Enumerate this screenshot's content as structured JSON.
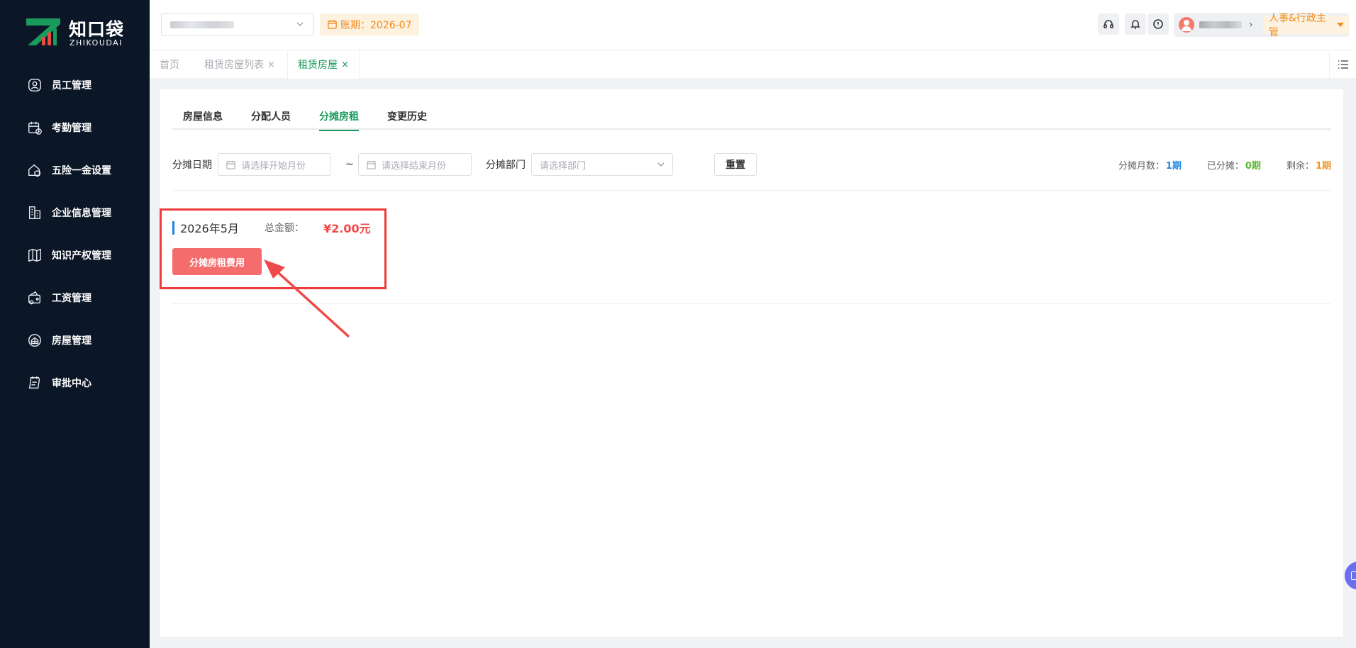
{
  "brand": {
    "name": "知口袋",
    "sub": "ZHIKOUDAI",
    "accent": "#1a9a5b",
    "sidebar_bg": "#0b1627"
  },
  "sidebar": {
    "items": [
      {
        "label": "员工管理",
        "icon": "user-circle-icon"
      },
      {
        "label": "考勤管理",
        "icon": "calendar-clock-icon"
      },
      {
        "label": "五险一金设置",
        "icon": "house-shield-icon"
      },
      {
        "label": "企业信息管理",
        "icon": "building-icon"
      },
      {
        "label": "知识产权管理",
        "icon": "book-icon"
      },
      {
        "label": "工资管理",
        "icon": "wallet-icon"
      },
      {
        "label": "房屋管理",
        "icon": "house-grid-icon"
      },
      {
        "label": "审批中心",
        "icon": "clipboard-icon"
      }
    ]
  },
  "header": {
    "period_label": "账期：2026-07",
    "role_label": "人事&行政主管"
  },
  "page_tabs": [
    {
      "label": "首页"
    },
    {
      "label": "租赁房屋列表",
      "close": "×"
    },
    {
      "label": "租赁房屋",
      "close": "×"
    }
  ],
  "inner_tabs": [
    "房屋信息",
    "分配人员",
    "分摊房租",
    "变更历史"
  ],
  "filter": {
    "date_label": "分摊日期",
    "start_placeholder": "请选择开始月份",
    "separator": "~",
    "end_placeholder": "请选择结束月份",
    "dept_label": "分摊部门",
    "dept_placeholder": "请选择部门",
    "reset_label": "重置"
  },
  "stats": [
    {
      "label": "分摊月数：",
      "value": "1期",
      "color": "#1c84e8"
    },
    {
      "label": "已分摊：",
      "value": "0期",
      "color": "#5ab832"
    },
    {
      "label": "剩余：",
      "value": "1期",
      "color": "#f0961a"
    }
  ],
  "period_card": {
    "month": "2026年5月",
    "total_label": "总金额：",
    "total_value": "¥2.00元",
    "button_label": "分摊房租费用"
  }
}
